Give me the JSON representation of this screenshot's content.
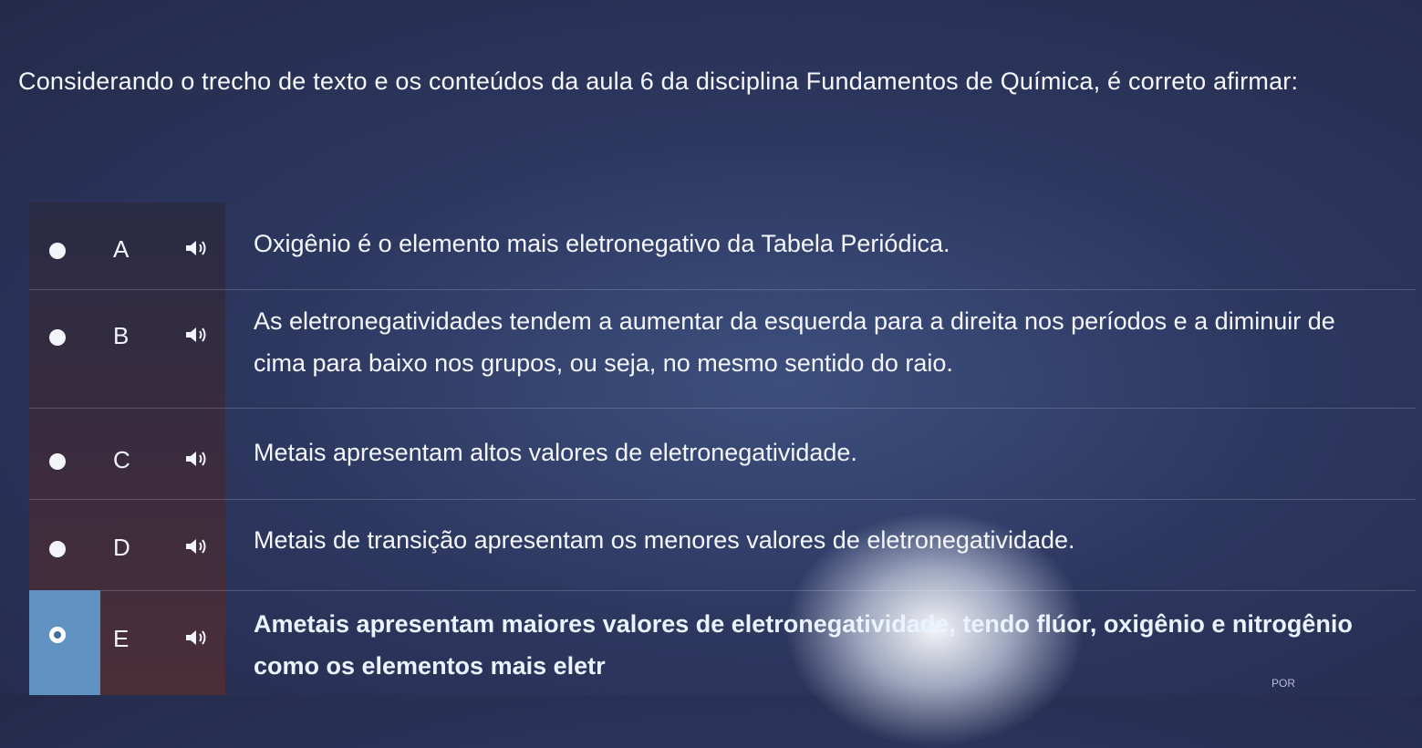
{
  "question": {
    "text": "Considerando o trecho de texto e os conteúdos da aula 6 da disciplina Fundamentos de Química, é correto afirmar:"
  },
  "options": [
    {
      "letter": "A",
      "text": "Oxigênio é o elemento mais eletronegativo da Tabela Periódica.",
      "selected": false
    },
    {
      "letter": "B",
      "text": "As eletronegatividades tendem a aumentar da esquerda para a direita nos períodos e a diminuir de cima para baixo nos grupos, ou seja, no mesmo sentido do raio.",
      "selected": false
    },
    {
      "letter": "C",
      "text": "Metais apresentam altos valores de eletronegatividade.",
      "selected": false
    },
    {
      "letter": "D",
      "text": "Metais de transição apresentam os menores valores de eletronegatividade.",
      "selected": false
    },
    {
      "letter": "E",
      "text": "Ametais apresentam maiores valores de eletronegatividade, tendo flúor, oxigênio e nitrogênio como os elementos mais eletr",
      "selected": true
    }
  ],
  "taskbar": {
    "language": "POR"
  },
  "colors": {
    "background": "#2d3860",
    "selected_accent": "#5f92c0",
    "text": "#f4f6fc"
  }
}
